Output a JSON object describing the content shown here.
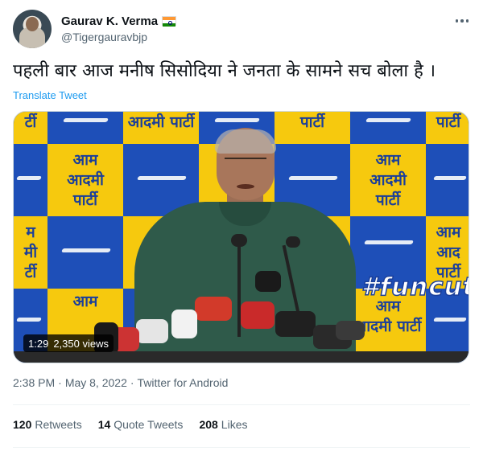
{
  "author": {
    "display_name": "Gaurav K. Verma",
    "flag": "india-flag-icon",
    "handle": "@Tigergauravbjp"
  },
  "tweet": {
    "text": "पहली बार आज मनीष सिसोदिया ने जनता के सामने सच बोला है ।",
    "translate_label": "Translate Tweet"
  },
  "media": {
    "duration": "1:29",
    "views": "2,350 views",
    "watermark": "#funcut",
    "backdrop_text": {
      "full": [
        "आम",
        "आदमी",
        "पार्टी"
      ],
      "top_right": "पार्टी",
      "top_mid": "आदमी पार्टी",
      "left_partial": [
        "म",
        "मी",
        "र्टी"
      ],
      "right_partial": [
        "आम",
        "आद",
        "पार्टी"
      ],
      "mid_partial": [
        "आ",
        "आ"
      ],
      "bottom_mid": [
        "आम",
        "आदमी पार्टी"
      ],
      "bottom_left": "आम"
    }
  },
  "meta": {
    "time": "2:38 PM",
    "separator": "·",
    "date": "May 8, 2022",
    "source": "Twitter for Android"
  },
  "stats": {
    "retweets_count": "120",
    "retweets_label": "Retweets",
    "quotes_count": "14",
    "quotes_label": "Quote Tweets",
    "likes_count": "208",
    "likes_label": "Likes"
  },
  "colors": {
    "link": "#1d9bf0",
    "secondary_text": "#536471",
    "aap_yellow": "#f6c90e",
    "aap_blue": "#1e4fb8"
  }
}
